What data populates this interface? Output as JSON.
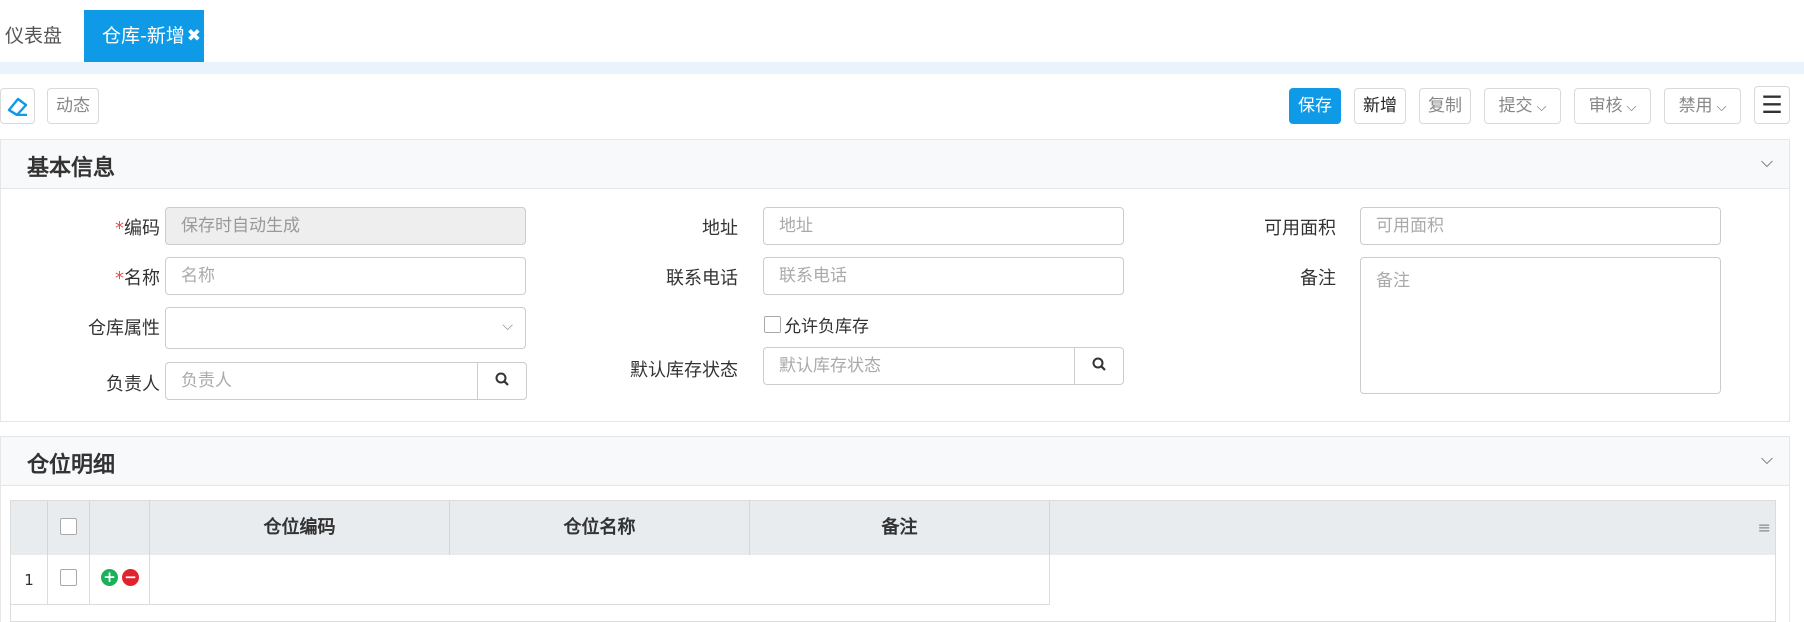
{
  "tabs": {
    "dashboard": "仪表盘",
    "active": "仓库-新增",
    "close_icon": "✖"
  },
  "toolbar": {
    "eraser_icon": "eraser-icon",
    "dynamic": "动态",
    "save": "保存",
    "add": "新增",
    "copy": "复制",
    "submit": "提交",
    "audit": "审核",
    "disable": "禁用",
    "menu_icon": "☰"
  },
  "basic_info": {
    "title": "基本信息",
    "fields": {
      "code_label": "编码",
      "code_placeholder": "保存时自动生成",
      "name_label": "名称",
      "name_placeholder": "名称",
      "attr_label": "仓库属性",
      "owner_label": "负责人",
      "owner_placeholder": "负责人",
      "address_label": "地址",
      "address_placeholder": "地址",
      "phone_label": "联系电话",
      "phone_placeholder": "联系电话",
      "allow_negative": "允许负库存",
      "default_status_label": "默认库存状态",
      "default_status_placeholder": "默认库存状态",
      "area_label": "可用面积",
      "area_placeholder": "可用面积",
      "remark_label": "备注",
      "remark_placeholder": "备注"
    },
    "required_mark": "*"
  },
  "detail": {
    "title": "仓位明细",
    "columns": [
      "仓位编码",
      "仓位名称",
      "备注"
    ],
    "rows": [
      {
        "index": "1"
      }
    ]
  },
  "colors": {
    "primary": "#0f9ae7",
    "required": "#d9534f",
    "add_icon": "#1bb05a",
    "remove_icon": "#e0242f"
  }
}
